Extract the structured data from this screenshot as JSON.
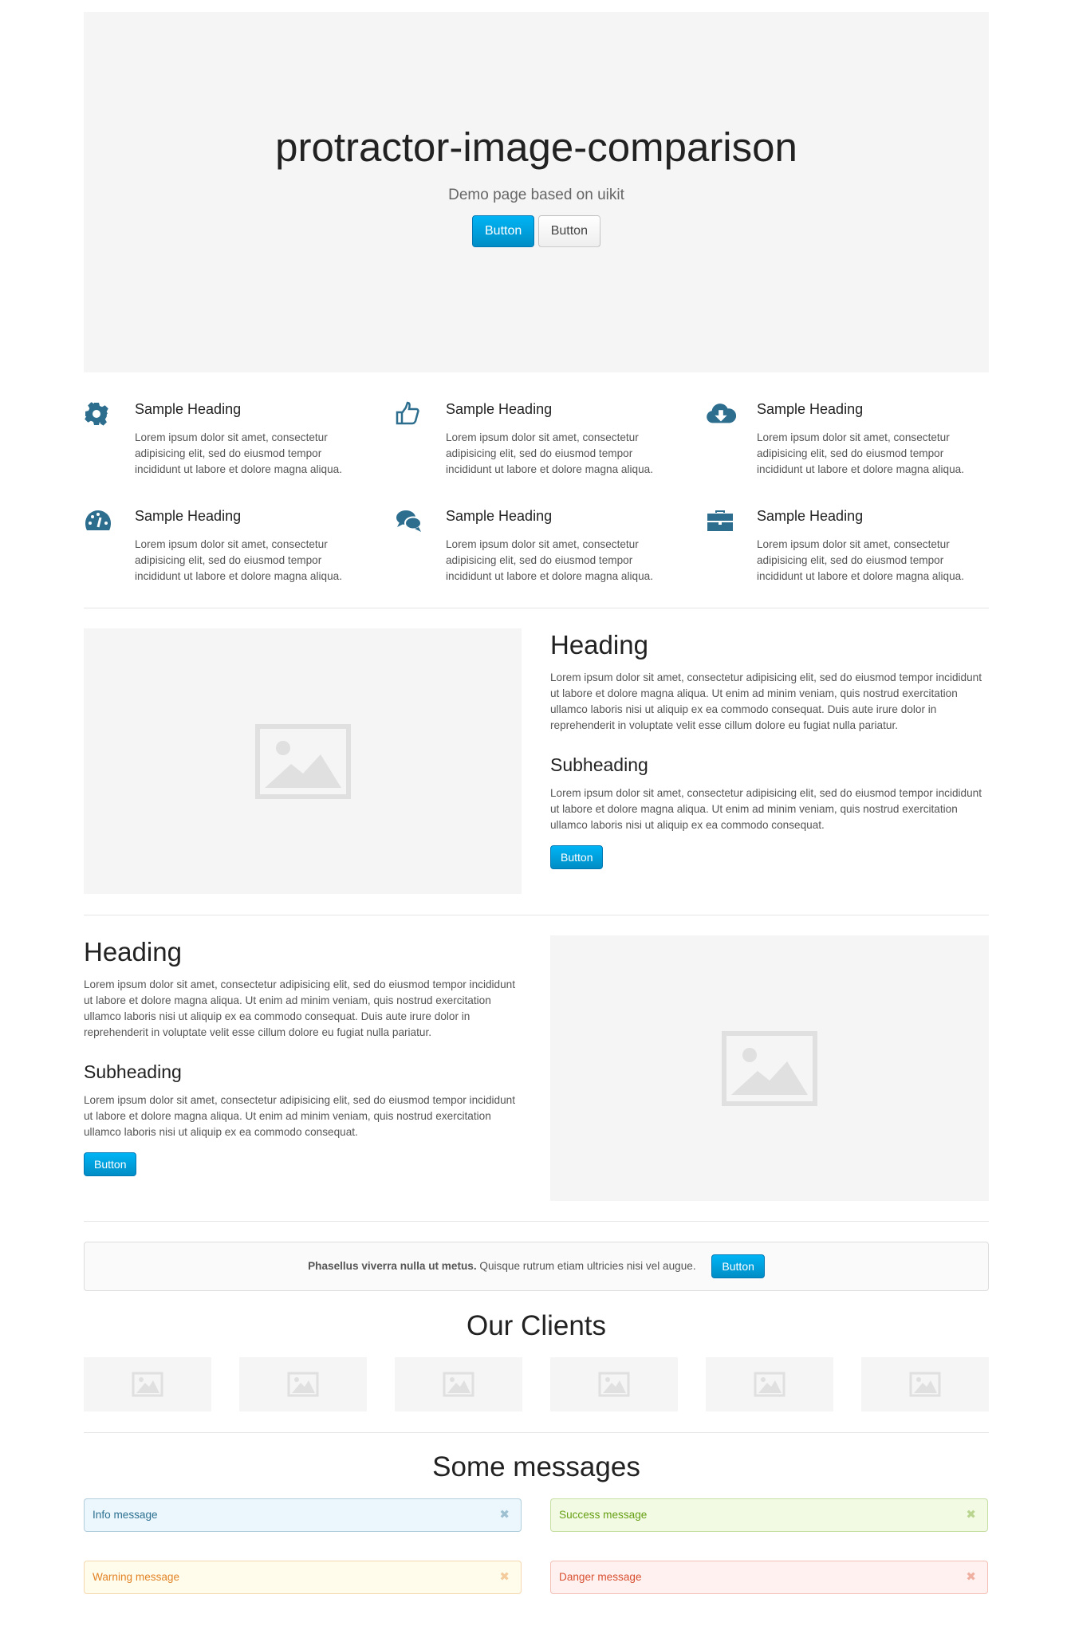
{
  "hero": {
    "title": "protractor-image-comparison",
    "subtitle": "Demo page based on uikit",
    "primary_button": "Button",
    "default_button": "Button"
  },
  "features": [
    {
      "icon": "gear-icon",
      "heading": "Sample Heading",
      "text": "Lorem ipsum dolor sit amet, consectetur adipisicing elit, sed do eiusmod tempor incididunt ut labore et dolore magna aliqua."
    },
    {
      "icon": "thumbs-up-icon",
      "heading": "Sample Heading",
      "text": "Lorem ipsum dolor sit amet, consectetur adipisicing elit, sed do eiusmod tempor incididunt ut labore et dolore magna aliqua."
    },
    {
      "icon": "cloud-download-icon",
      "heading": "Sample Heading",
      "text": "Lorem ipsum dolor sit amet, consectetur adipisicing elit, sed do eiusmod tempor incididunt ut labore et dolore magna aliqua."
    },
    {
      "icon": "dashboard-icon",
      "heading": "Sample Heading",
      "text": "Lorem ipsum dolor sit amet, consectetur adipisicing elit, sed do eiusmod tempor incididunt ut labore et dolore magna aliqua."
    },
    {
      "icon": "comments-icon",
      "heading": "Sample Heading",
      "text": "Lorem ipsum dolor sit amet, consectetur adipisicing elit, sed do eiusmod tempor incididunt ut labore et dolore magna aliqua."
    },
    {
      "icon": "briefcase-icon",
      "heading": "Sample Heading",
      "text": "Lorem ipsum dolor sit amet, consectetur adipisicing elit, sed do eiusmod tempor incididunt ut labore et dolore magna aliqua."
    }
  ],
  "sections": [
    {
      "heading": "Heading",
      "text": "Lorem ipsum dolor sit amet, consectetur adipisicing elit, sed do eiusmod tempor incididunt ut labore et dolore magna aliqua. Ut enim ad minim veniam, quis nostrud exercitation ullamco laboris nisi ut aliquip ex ea commodo consequat. Duis aute irure dolor in reprehenderit in voluptate velit esse cillum dolore eu fugiat nulla pariatur.",
      "subheading": "Subheading",
      "subtext": "Lorem ipsum dolor sit amet, consectetur adipisicing elit, sed do eiusmod tempor incididunt ut labore et dolore magna aliqua. Ut enim ad minim veniam, quis nostrud exercitation ullamco laboris nisi ut aliquip ex ea commodo consequat.",
      "button": "Button"
    },
    {
      "heading": "Heading",
      "text": "Lorem ipsum dolor sit amet, consectetur adipisicing elit, sed do eiusmod tempor incididunt ut labore et dolore magna aliqua. Ut enim ad minim veniam, quis nostrud exercitation ullamco laboris nisi ut aliquip ex ea commodo consequat. Duis aute irure dolor in reprehenderit in voluptate velit esse cillum dolore eu fugiat nulla pariatur.",
      "subheading": "Subheading",
      "subtext": "Lorem ipsum dolor sit amet, consectetur adipisicing elit, sed do eiusmod tempor incididunt ut labore et dolore magna aliqua. Ut enim ad minim veniam, quis nostrud exercitation ullamco laboris nisi ut aliquip ex ea commodo consequat.",
      "button": "Button"
    }
  ],
  "panel": {
    "bold": "Phasellus viverra nulla ut metus.",
    "text": " Quisque rutrum etiam ultricies nisi vel augue.",
    "button": "Button"
  },
  "clients": {
    "title": "Our Clients"
  },
  "messages": {
    "title": "Some messages",
    "close": "✖",
    "alerts": [
      {
        "text": "Info message",
        "bg": "#ebf7fd",
        "border": "rgba(45,112,145,0.3)",
        "color": "#2d7091"
      },
      {
        "text": "Success message",
        "bg": "#f2fae3",
        "border": "rgba(101,159,19,0.3)",
        "color": "#659f13"
      },
      {
        "text": "Warning message",
        "bg": "#fffceb",
        "border": "rgba(226,131,39,0.3)",
        "color": "#e28327"
      },
      {
        "text": "Danger message",
        "bg": "#fff1f0",
        "border": "rgba(216,80,48,0.3)",
        "color": "#d85030"
      }
    ]
  },
  "colors": {
    "accent": "#00a8e6",
    "icon": "#2d6e8f"
  }
}
